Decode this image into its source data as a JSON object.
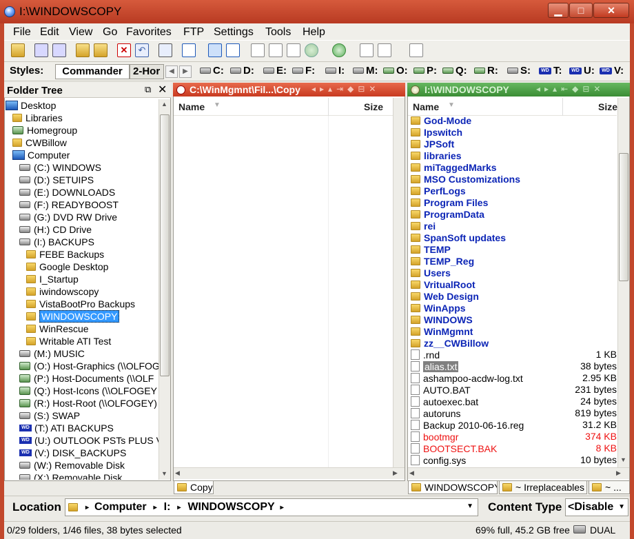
{
  "window": {
    "title": "I:\\WINDOWSCOPY",
    "minimize": "▁",
    "maximize": "□",
    "close": "✕"
  },
  "menu": [
    "File",
    "Edit",
    "View",
    "Go",
    "Favorites",
    "FTP",
    "Settings",
    "Tools",
    "Help"
  ],
  "styles": {
    "label": "Styles:",
    "tab1": "Commander",
    "tab2": "2-Hor"
  },
  "drives": [
    {
      "letter": "C:",
      "type": "hdd"
    },
    {
      "letter": "D:",
      "type": "hdd"
    },
    {
      "letter": "E:",
      "type": "hdd"
    },
    {
      "letter": "F:",
      "type": "hdd"
    },
    {
      "letter": "I:",
      "type": "hdd"
    },
    {
      "letter": "M:",
      "type": "hdd"
    },
    {
      "letter": "O:",
      "type": "net"
    },
    {
      "letter": "P:",
      "type": "net"
    },
    {
      "letter": "Q:",
      "type": "net"
    },
    {
      "letter": "R:",
      "type": "net"
    },
    {
      "letter": "S:",
      "type": "hdd"
    },
    {
      "letter": "T:",
      "type": "wd"
    },
    {
      "letter": "U:",
      "type": "wd"
    },
    {
      "letter": "V:",
      "type": "wd"
    }
  ],
  "tree": {
    "title": "Folder Tree",
    "items": [
      {
        "label": "Desktop",
        "level": 0,
        "icon": "computer-icon"
      },
      {
        "label": "Libraries",
        "level": 1,
        "icon": "folder-icon"
      },
      {
        "label": "Homegroup",
        "level": 1,
        "icon": "homegroup-icon"
      },
      {
        "label": "CWBillow",
        "level": 1,
        "icon": "user-folder-icon"
      },
      {
        "label": "Computer",
        "level": 1,
        "icon": "computer-icon"
      },
      {
        "label": "(C:) WINDOWS",
        "level": 2,
        "icon": "hdd-icon"
      },
      {
        "label": "(D:) SETUIPS",
        "level": 2,
        "icon": "hdd-icon"
      },
      {
        "label": "(E:) DOWNLOADS",
        "level": 2,
        "icon": "hdd-icon"
      },
      {
        "label": "(F:) READYBOOST",
        "level": 2,
        "icon": "hdd-icon"
      },
      {
        "label": "(G:) DVD RW Drive",
        "level": 2,
        "icon": "hdd-icon"
      },
      {
        "label": "(H:) CD Drive",
        "level": 2,
        "icon": "hdd-icon"
      },
      {
        "label": "(I:) BACKUPS",
        "level": 2,
        "icon": "hdd-icon"
      },
      {
        "label": "FEBE Backups",
        "level": 3,
        "icon": "folder-icon"
      },
      {
        "label": "Google Desktop",
        "level": 3,
        "icon": "folder-icon"
      },
      {
        "label": "I_Startup",
        "level": 3,
        "icon": "folder-icon"
      },
      {
        "label": "iwindowscopy",
        "level": 3,
        "icon": "folder-icon"
      },
      {
        "label": "VistaBootPro Backups",
        "level": 3,
        "icon": "folder-icon"
      },
      {
        "label": "WINDOWSCOPY",
        "level": 3,
        "icon": "folder-icon",
        "selected": true
      },
      {
        "label": "WinRescue",
        "level": 3,
        "icon": "folder-icon"
      },
      {
        "label": "Writable ATI Test",
        "level": 3,
        "icon": "folder-icon"
      },
      {
        "label": "(M:) MUSIC",
        "level": 2,
        "icon": "hdd-icon"
      },
      {
        "label": "(O:) Host-Graphics (\\\\OLFOG",
        "level": 2,
        "icon": "net-icon"
      },
      {
        "label": "(P:) Host-Documents (\\\\OLF",
        "level": 2,
        "icon": "net-icon"
      },
      {
        "label": "(Q:) Host-Icons (\\\\OLFOGEY",
        "level": 2,
        "icon": "net-icon"
      },
      {
        "label": "(R:) Host-Root (\\\\OLFOGEY)",
        "level": 2,
        "icon": "net-icon"
      },
      {
        "label": "(S:) SWAP",
        "level": 2,
        "icon": "hdd-icon"
      },
      {
        "label": "(T:) ATI BACKUPS",
        "level": 2,
        "icon": "wd-icon"
      },
      {
        "label": "(U:) OUTLOOK PSTs PLUS V",
        "level": 2,
        "icon": "wd-icon"
      },
      {
        "label": "(V:) DISK_BACKUPS",
        "level": 2,
        "icon": "wd-icon"
      },
      {
        "label": "(W:) Removable Disk",
        "level": 2,
        "icon": "hdd-icon"
      },
      {
        "label": "(X:) Removable Disk",
        "level": 2,
        "icon": "hdd-icon"
      }
    ]
  },
  "left_pane": {
    "path": "C:\\WinMgmnt\\Fil...\\Copy",
    "col_name": "Name",
    "col_size": "Size",
    "tabs": [
      "Copy"
    ]
  },
  "right_pane": {
    "path": "I:\\WINDOWSCOPY",
    "col_name": "Name",
    "col_size": "Size",
    "rows": [
      {
        "name": "God-Mode",
        "size": "",
        "kind": "dir"
      },
      {
        "name": "Ipswitch",
        "size": "",
        "kind": "dir"
      },
      {
        "name": "JPSoft",
        "size": "",
        "kind": "dir"
      },
      {
        "name": "libraries",
        "size": "",
        "kind": "dir"
      },
      {
        "name": "miTaggedMarks",
        "size": "",
        "kind": "dir"
      },
      {
        "name": "MSO Customizations",
        "size": "",
        "kind": "dir"
      },
      {
        "name": "PerfLogs",
        "size": "",
        "kind": "dir"
      },
      {
        "name": "Program Files",
        "size": "",
        "kind": "dir"
      },
      {
        "name": "ProgramData",
        "size": "",
        "kind": "dir"
      },
      {
        "name": "rei",
        "size": "",
        "kind": "dir"
      },
      {
        "name": "SpanSoft updates",
        "size": "",
        "kind": "dir"
      },
      {
        "name": "TEMP",
        "size": "",
        "kind": "dir"
      },
      {
        "name": "TEMP_Reg",
        "size": "",
        "kind": "dir"
      },
      {
        "name": "Users",
        "size": "",
        "kind": "dir"
      },
      {
        "name": "VritualRoot",
        "size": "",
        "kind": "dir"
      },
      {
        "name": "Web Design",
        "size": "",
        "kind": "dir"
      },
      {
        "name": "WinApps",
        "size": "",
        "kind": "dir"
      },
      {
        "name": "WINDOWS",
        "size": "",
        "kind": "dir"
      },
      {
        "name": "WinMgmnt",
        "size": "",
        "kind": "dir"
      },
      {
        "name": "zz__CWBillow",
        "size": "",
        "kind": "dir"
      },
      {
        "name": ".rnd",
        "size": "1 KB",
        "kind": "file"
      },
      {
        "name": "alias.txt",
        "size": "38 bytes",
        "kind": "file",
        "selected": true
      },
      {
        "name": "ashampoo-acdw-log.txt",
        "size": "2.95 KB",
        "kind": "file"
      },
      {
        "name": "AUTO.BAT",
        "size": "231 bytes",
        "kind": "file"
      },
      {
        "name": "autoexec.bat",
        "size": "24 bytes",
        "kind": "file"
      },
      {
        "name": "autoruns",
        "size": "819 bytes",
        "kind": "file"
      },
      {
        "name": "Backup 2010-06-16.reg",
        "size": "31.2 KB",
        "kind": "file"
      },
      {
        "name": "bootmgr",
        "size": "374 KB",
        "kind": "red"
      },
      {
        "name": "BOOTSECT.BAK",
        "size": "8 KB",
        "kind": "red"
      },
      {
        "name": "config.sys",
        "size": "10 bytes",
        "kind": "file"
      }
    ],
    "tabs": [
      "WINDOWSCOPY",
      "~ Irreplaceables",
      "~ ..."
    ]
  },
  "location": {
    "label": "Location",
    "crumbs": [
      "Computer",
      "I:",
      "WINDOWSCOPY"
    ]
  },
  "content_type": {
    "label": "Content Type",
    "value": "<Disable"
  },
  "status": {
    "left": "0/29 folders, 1/46 files, 38 bytes selected",
    "right": "69% full, 45.2 GB free",
    "mode": "DUAL"
  },
  "colors": {
    "title_bar": "#c2482c",
    "left_pane_header": "#d84a2c",
    "right_pane_header": "#4aa044",
    "folder_text": "#0c25b6",
    "system_file_text": "#e11111",
    "selection": "#3399ff"
  }
}
